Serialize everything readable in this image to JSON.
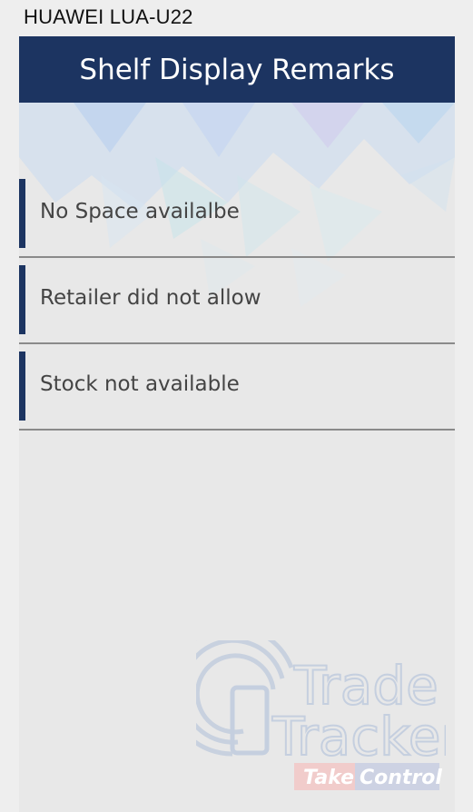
{
  "device": {
    "model": "HUAWEI LUA-U22"
  },
  "header": {
    "title": "Shelf Display Remarks"
  },
  "remarks": [
    {
      "label": "No Space availalbe"
    },
    {
      "label": "Retailer did not allow"
    },
    {
      "label": "Stock not available"
    }
  ],
  "branding": {
    "logo_line1": "Trade",
    "logo_line2": "Tracker",
    "tagline_part1": "Take",
    "tagline_part2": "Control"
  },
  "colors": {
    "header_bg": "#1c3461",
    "accent": "#1c3461",
    "divider": "#8a8a8a"
  }
}
